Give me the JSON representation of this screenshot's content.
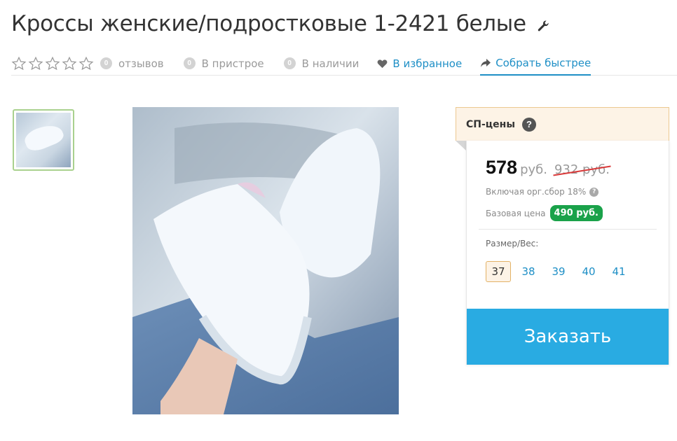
{
  "product": {
    "title": "Кроссы женские/подростковые 1-2421 белые"
  },
  "meta": {
    "rating_count": "0",
    "reviews_label": "отзывов",
    "attach_count": "0",
    "attach_label": "В пристрое",
    "stock_count": "0",
    "stock_label": "В наличии",
    "favorite_label": "В избранное",
    "fast_label": "Собрать быстрее"
  },
  "pricing": {
    "header": "СП-цены",
    "help": "?",
    "price": "578",
    "currency": "руб.",
    "old_price": "932 руб.",
    "fee_label": "Включая орг.сбор 18%",
    "fee_help": "?",
    "base_label": "Базовая цена",
    "base_price": "490 руб.",
    "size_label": "Размер/Вес:",
    "sizes": [
      "37",
      "38",
      "39",
      "40",
      "41"
    ],
    "selected_size": "37",
    "order_button": "Заказать"
  },
  "colors": {
    "link": "#1e8fc6",
    "order_button": "#29abe2",
    "base_badge": "#1aa24a",
    "old_price_strike": "#d93a3a"
  }
}
